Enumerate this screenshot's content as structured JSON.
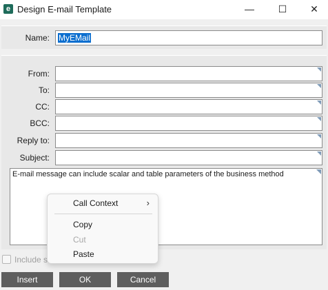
{
  "window": {
    "title": "Design E-mail Template",
    "app_icon_letter": "e",
    "minimize_glyph": "—",
    "maximize_glyph": "☐",
    "close_glyph": "✕"
  },
  "name_field": {
    "label": "Name:",
    "value": "MyEMail"
  },
  "fields": {
    "from_label": "From:",
    "to_label": "To:",
    "cc_label": "CC:",
    "bcc_label": "BCC:",
    "reply_to_label": "Reply to:",
    "subject_label": "Subject:"
  },
  "body": {
    "text": "E-mail message can include scalar and table parameters of the business method"
  },
  "checkbox": {
    "label": "Include sl",
    "checked": false
  },
  "buttons": {
    "insert": "Insert",
    "ok": "OK",
    "cancel": "Cancel"
  },
  "context_menu": {
    "call_context": "Call Context",
    "submenu_arrow": "›",
    "copy": "Copy",
    "cut": "Cut",
    "paste": "Paste"
  },
  "colors": {
    "selection": "#0b6ecf",
    "button_bg": "#5e5e5e",
    "app_icon": "#1e6b5a"
  },
  "icons": [
    "app-logo-icon",
    "minimize-icon",
    "maximize-icon",
    "close-icon",
    "chevron-right-icon"
  ]
}
